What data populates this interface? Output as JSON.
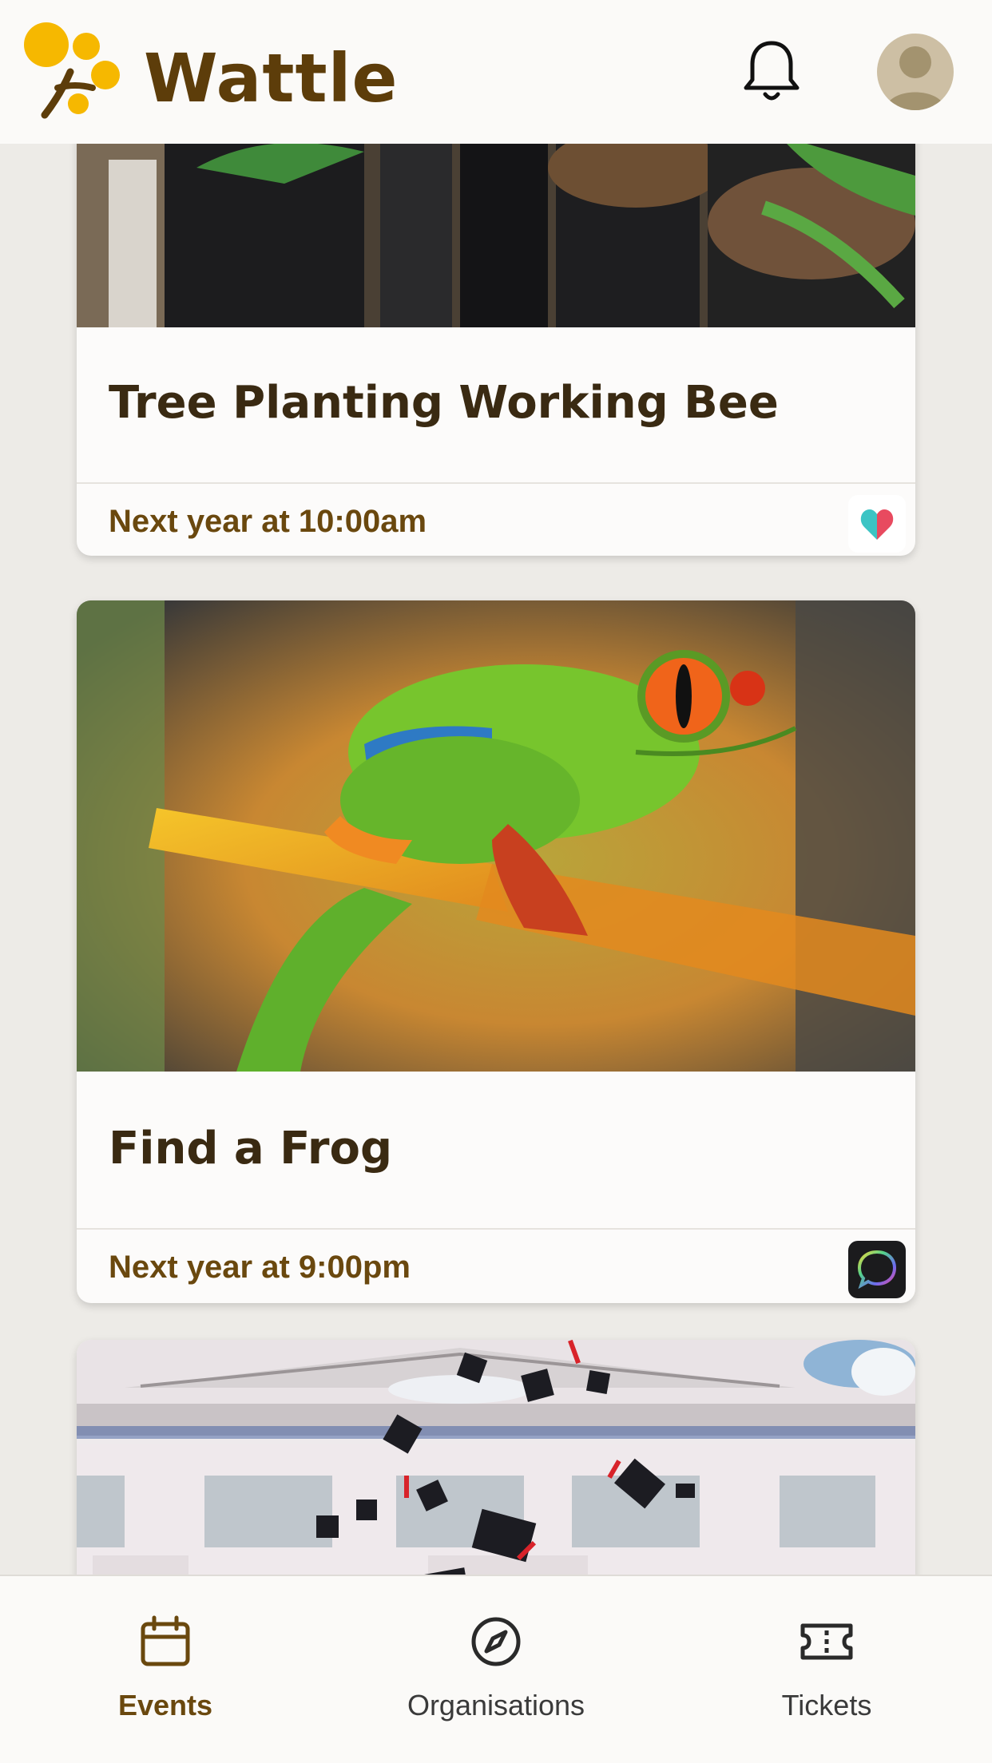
{
  "app": {
    "name": "Wattle"
  },
  "header": {
    "notifications_icon": "bell-icon",
    "avatar_icon": "user-avatar"
  },
  "events": [
    {
      "title": "Tree Planting Working Bee",
      "time": "Next year at 10:00am",
      "image": "seedlings-in-pots",
      "org_icon": "heart-logo"
    },
    {
      "title": "Find a Frog",
      "time": "Next year at 9:00pm",
      "image": "red-eyed-tree-frog",
      "org_icon": "speech-bubble-logo"
    },
    {
      "title": "",
      "time": "",
      "image": "graduation-caps-building",
      "org_icon": ""
    }
  ],
  "nav": {
    "items": [
      {
        "label": "Events",
        "icon": "calendar-icon",
        "active": true
      },
      {
        "label": "Organisations",
        "icon": "compass-icon",
        "active": false
      },
      {
        "label": "Tickets",
        "icon": "ticket-icon",
        "active": false
      }
    ]
  },
  "colors": {
    "brand": "#5d3d0a",
    "accent_yellow": "#f6b800",
    "background": "#edebe7",
    "active_nav": "#6a480e"
  }
}
